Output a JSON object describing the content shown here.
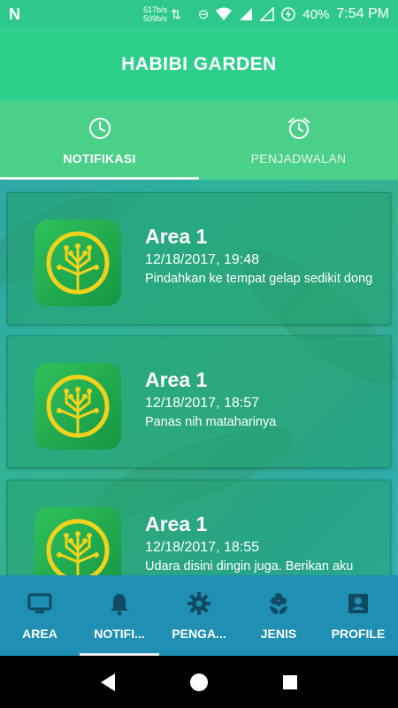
{
  "status_bar": {
    "net_up": "517b/s",
    "net_down": "509b/s",
    "battery": "40%",
    "time": "7:54 PM"
  },
  "app": {
    "title": "HABIBI GARDEN"
  },
  "tabs": [
    {
      "label": "NOTIFIKASI",
      "icon": "clock-icon",
      "active": true
    },
    {
      "label": "PENJADWALAN",
      "icon": "alarm-clock-icon",
      "active": false
    }
  ],
  "notifications": [
    {
      "title": "Area 1",
      "datetime": "12/18/2017, 19:48",
      "message": "Pindahkan ke tempat gelap sedikit dong"
    },
    {
      "title": "Area 1",
      "datetime": "12/18/2017, 18:57",
      "message": "Panas nih mataharinya"
    },
    {
      "title": "Area 1",
      "datetime": "12/18/2017, 18:55",
      "message": "Udara disini dingin juga. Berikan aku"
    }
  ],
  "bottom_nav": [
    {
      "label": "AREA",
      "icon": "monitor-icon"
    },
    {
      "label": "NOTIFI...",
      "icon": "bell-icon",
      "active": true
    },
    {
      "label": "PENGA...",
      "icon": "gear-icon"
    },
    {
      "label": "JENIS",
      "icon": "flower-icon"
    },
    {
      "label": "PROFILE",
      "icon": "profile-icon"
    }
  ],
  "colors": {
    "status_bar": "#2ec98a",
    "app_bar": "#2ecf8b",
    "tabs": "#4bd08a",
    "bottom_nav": "#1f8fb4",
    "logo_ring": "#f2d21c"
  }
}
